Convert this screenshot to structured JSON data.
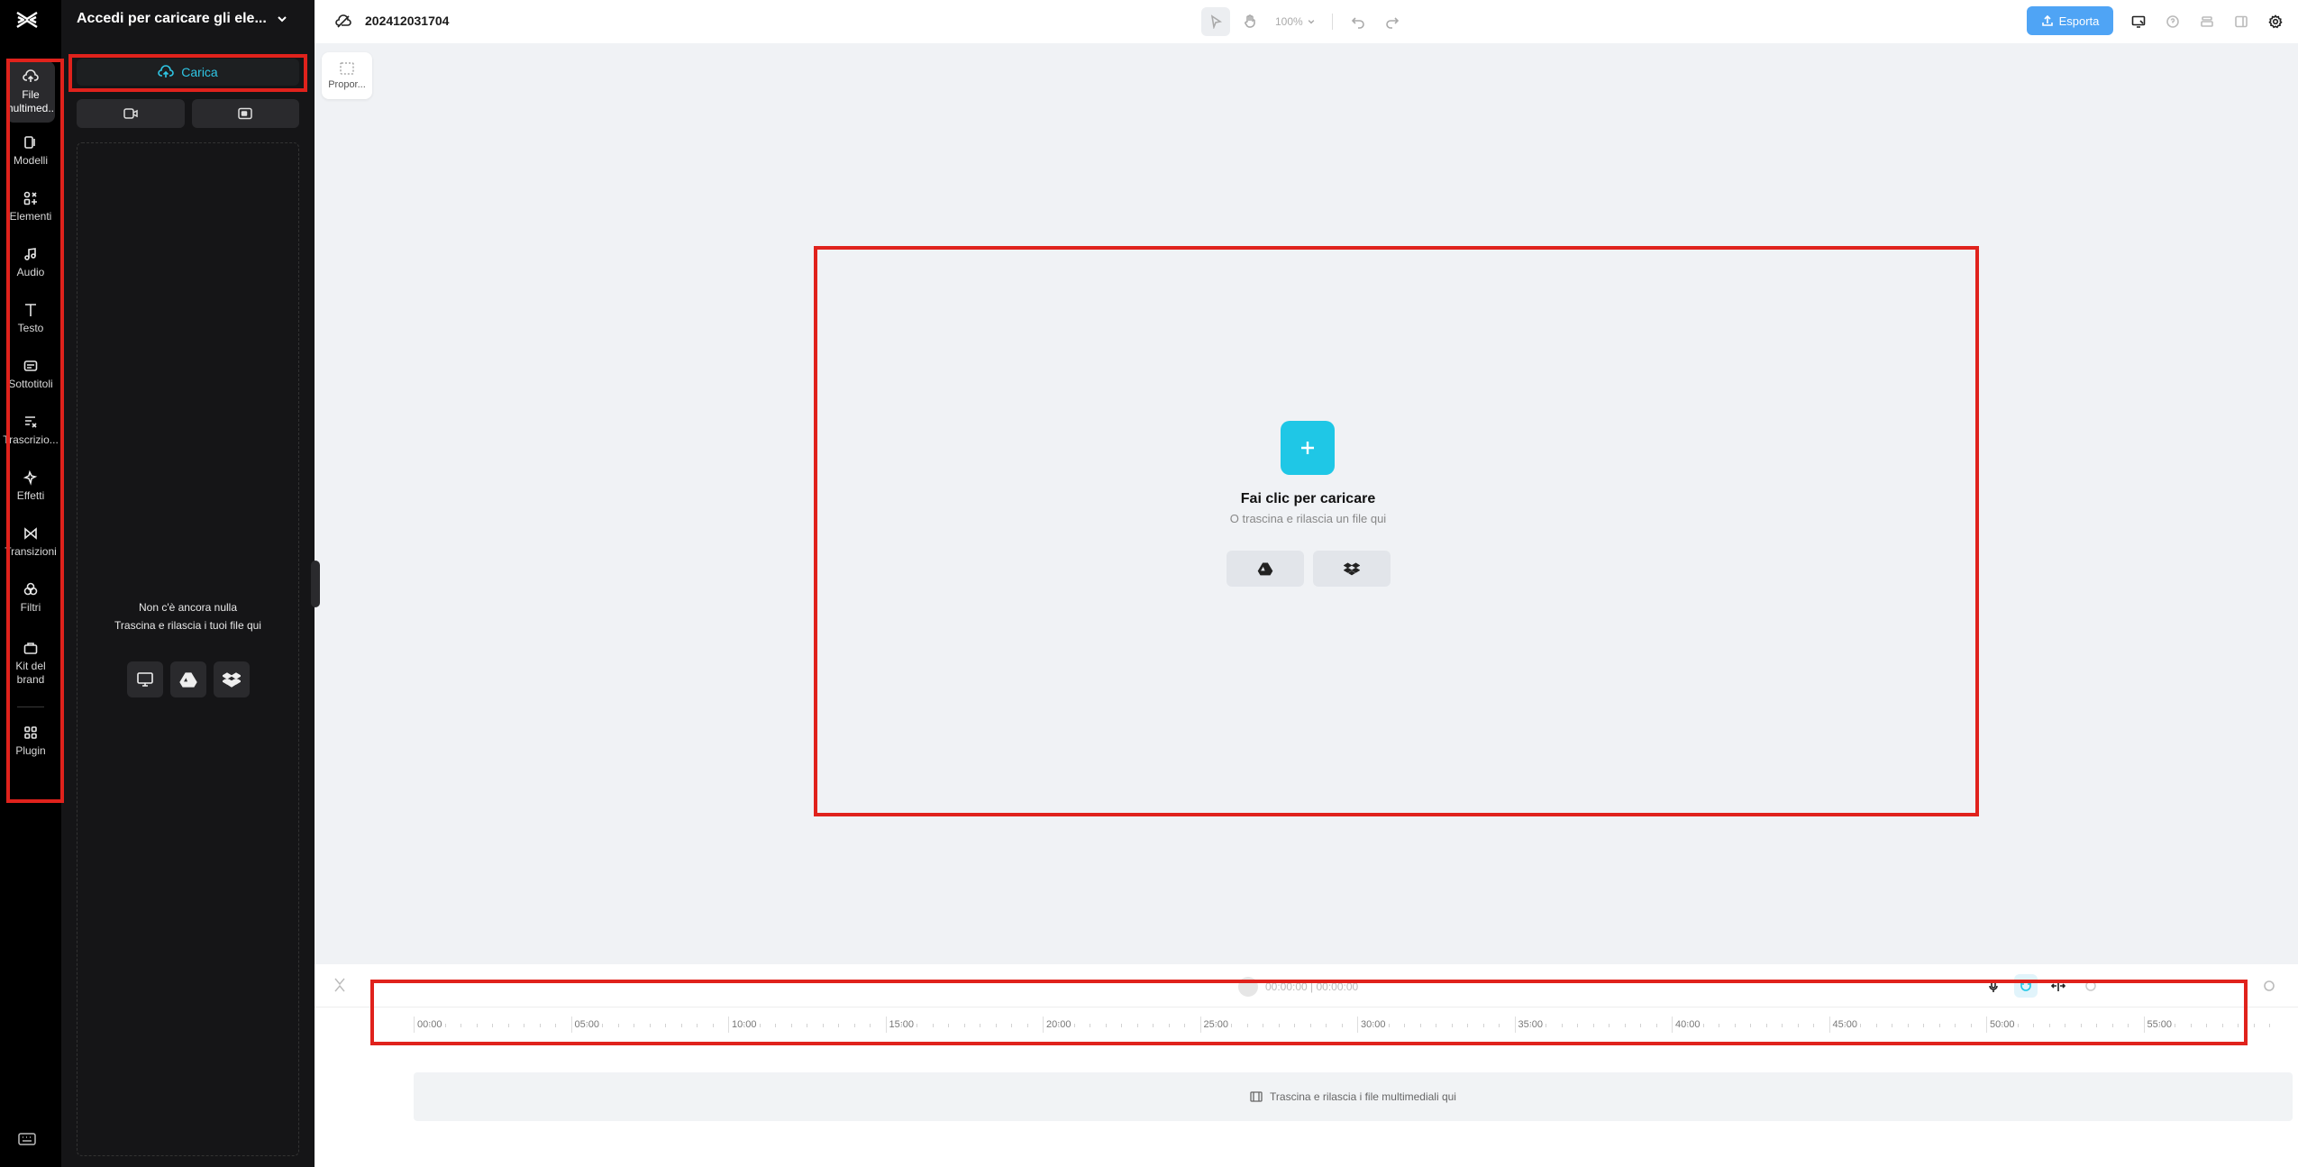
{
  "app": {
    "logo": "capcut-logo-icon"
  },
  "project": {
    "name": "202412031704"
  },
  "panel": {
    "title": "Accedi per caricare gli ele...",
    "upload_label": "Carica",
    "empty_line1": "Non c'è ancora nulla",
    "empty_line2": "Trascina e rilascia i tuoi file qui"
  },
  "rail": {
    "items": [
      {
        "label": "File multimed...",
        "icon": "cloud-upload-icon",
        "active": true
      },
      {
        "label": "Modelli",
        "icon": "template-icon"
      },
      {
        "label": "Elementi",
        "icon": "elements-icon"
      },
      {
        "label": "Audio",
        "icon": "music-icon"
      },
      {
        "label": "Testo",
        "icon": "text-icon"
      },
      {
        "label": "Sottotitoli",
        "icon": "captions-icon"
      },
      {
        "label": "Trascrizio...",
        "icon": "transcript-icon"
      },
      {
        "label": "Effetti",
        "icon": "effects-icon"
      },
      {
        "label": "Transizioni",
        "icon": "transitions-icon"
      },
      {
        "label": "Filtri",
        "icon": "filters-icon"
      },
      {
        "label": "Kit del brand",
        "icon": "brand-kit-icon"
      },
      {
        "label": "Plugin",
        "icon": "plugin-icon"
      }
    ]
  },
  "toolbar": {
    "zoom": "100%",
    "export_label": "Esporta"
  },
  "ratio": {
    "label": "Propor..."
  },
  "canvas": {
    "title": "Fai clic per caricare",
    "subtitle": "O trascina e rilascia un file qui"
  },
  "timeline": {
    "play_text": "00:00:00 | 00:00:00",
    "ticks": [
      "00:00",
      "05:00",
      "10:00",
      "15:00",
      "20:00",
      "25:00",
      "30:00",
      "35:00",
      "40:00",
      "45:00",
      "50:00",
      "55:00"
    ],
    "drop_text": "Trascina e rilascia i file multimediali qui"
  },
  "colors": {
    "accent": "#1fc7e6",
    "export": "#3d9bf5",
    "annotation": "#e0221c",
    "rail_bg": "#000000",
    "panel_bg": "#151517"
  }
}
